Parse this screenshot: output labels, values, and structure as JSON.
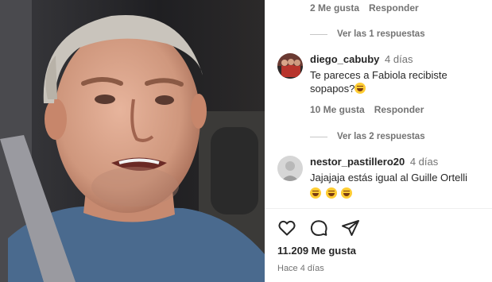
{
  "post": {
    "likes_label": "11.209 Me gusta",
    "time_label": "Hace 4 días"
  },
  "top_meta": {
    "likes": "2 Me gusta",
    "reply": "Responder"
  },
  "view_replies_1": "Ver las 1 respuestas",
  "view_replies_2": "Ver las 2 respuestas",
  "comments": [
    {
      "user": "diego_cabuby",
      "time": "4 días",
      "text": "Te pareces a Fabiola recibiste sopapos?",
      "emojis": [
        "grinning-sweat-emoji"
      ],
      "likes": "10 Me gusta",
      "reply": "Responder"
    },
    {
      "user": "nestor_pastillero20",
      "time": "4 días",
      "text": "Jajajaja estás igual al Guille Ortelli",
      "emojis": [
        "grinning-sweat-emoji",
        "grinning-sweat-emoji",
        "grinning-sweat-emoji"
      ]
    }
  ],
  "icons": [
    "heart-icon",
    "comment-icon",
    "share-icon"
  ]
}
